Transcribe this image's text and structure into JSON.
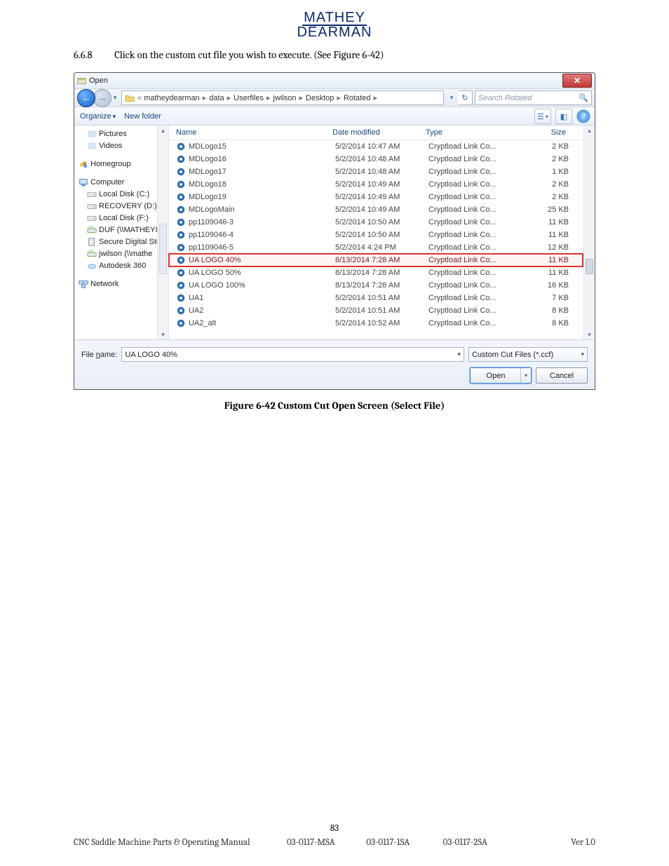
{
  "header": {
    "brand_line1": "Mathey",
    "brand_line2": "Dearman"
  },
  "instruction": {
    "number": "6.6.8",
    "text": "Click on the custom cut file you wish to execute. (See Figure 6-42)"
  },
  "dialog": {
    "title": "Open",
    "breadcrumb": [
      "matheydearman",
      "data",
      "Userfiles",
      "jwilson",
      "Desktop",
      "Rotated"
    ],
    "search_placeholder": "Search Rotated",
    "toolbar": {
      "organize": "Organize",
      "new_folder": "New folder"
    },
    "columns": {
      "name": "Name",
      "date": "Date modified",
      "type": "Type",
      "size": "Size"
    },
    "sidebar": [
      {
        "icon": "pictures",
        "label": "Pictures",
        "indent": 1
      },
      {
        "icon": "videos",
        "label": "Videos",
        "indent": 1
      },
      {
        "gap": true
      },
      {
        "icon": "homegroup",
        "label": "Homegroup",
        "indent": 0
      },
      {
        "gap": true
      },
      {
        "icon": "computer",
        "label": "Computer",
        "indent": 0
      },
      {
        "icon": "disk",
        "label": "Local Disk (C:)",
        "indent": 1
      },
      {
        "icon": "disk",
        "label": "RECOVERY (D:)",
        "indent": 1
      },
      {
        "icon": "disk",
        "label": "Local Disk (F:)",
        "indent": 1
      },
      {
        "icon": "netdrive",
        "label": "DUF (\\\\MATHEYI",
        "indent": 1
      },
      {
        "icon": "sd",
        "label": "Secure Digital Sto",
        "indent": 1
      },
      {
        "icon": "netdrive",
        "label": "jwilson (\\\\mathe",
        "indent": 1
      },
      {
        "icon": "cloud",
        "label": "Autodesk 360",
        "indent": 1
      },
      {
        "gap": true
      },
      {
        "icon": "network",
        "label": "Network",
        "indent": 0
      }
    ],
    "files": [
      {
        "name": "MDLogo15",
        "date": "5/2/2014 10:47 AM",
        "type": "Cryptload Link Co...",
        "size": "2 KB"
      },
      {
        "name": "MDLogo16",
        "date": "5/2/2014 10:48 AM",
        "type": "Cryptload Link Co...",
        "size": "2 KB"
      },
      {
        "name": "MDLogo17",
        "date": "5/2/2014 10:48 AM",
        "type": "Cryptload Link Co...",
        "size": "1 KB"
      },
      {
        "name": "MDLogo18",
        "date": "5/2/2014 10:49 AM",
        "type": "Cryptload Link Co...",
        "size": "2 KB"
      },
      {
        "name": "MDLogo19",
        "date": "5/2/2014 10:49 AM",
        "type": "Cryptload Link Co...",
        "size": "2 KB"
      },
      {
        "name": "MDLogoMain",
        "date": "5/2/2014 10:49 AM",
        "type": "Cryptload Link Co...",
        "size": "25 KB"
      },
      {
        "name": "pp1109046-3",
        "date": "5/2/2014 10:50 AM",
        "type": "Cryptload Link Co...",
        "size": "11 KB"
      },
      {
        "name": "pp1109046-4",
        "date": "5/2/2014 10:50 AM",
        "type": "Cryptload Link Co...",
        "size": "11 KB"
      },
      {
        "name": "pp1109046-5",
        "date": "5/2/2014 4:24 PM",
        "type": "Cryptload Link Co...",
        "size": "12 KB"
      },
      {
        "name": "UA LOGO 40%",
        "date": "8/13/2014 7:28 AM",
        "type": "Cryptload Link Co...",
        "size": "11 KB",
        "selected": true
      },
      {
        "name": "UA LOGO 50%",
        "date": "8/13/2014 7:28 AM",
        "type": "Cryptload Link Co...",
        "size": "11 KB"
      },
      {
        "name": "UA LOGO 100%",
        "date": "8/13/2014 7:28 AM",
        "type": "Cryptload Link Co...",
        "size": "16 KB"
      },
      {
        "name": "UA1",
        "date": "5/2/2014 10:51 AM",
        "type": "Cryptload Link Co...",
        "size": "7 KB"
      },
      {
        "name": "UA2",
        "date": "5/2/2014 10:51 AM",
        "type": "Cryptload Link Co...",
        "size": "8 KB"
      },
      {
        "name": "UA2_alt",
        "date": "5/2/2014 10:52 AM",
        "type": "Cryptload Link Co...",
        "size": "8 KB"
      }
    ],
    "filename": "UA LOGO 40%",
    "filetype": "Custom Cut Files (*.ccf)",
    "buttons": {
      "open": "Open",
      "cancel": "Cancel"
    }
  },
  "caption": "Figure 6-42 Custom Cut Open Screen (Select File)",
  "footer": {
    "page": "83",
    "title": "CNC Saddle Machine Parts & Operating Manual",
    "codes": [
      "03-0117-MSA",
      "03-0117-1SA",
      "03-0117-2SA"
    ],
    "version": "Ver 1.0"
  },
  "icons": {
    "pictures": "#5aa0e0",
    "videos": "#5aa0e0",
    "homegroup": "#d28a2d",
    "computer": "#3a6fb7",
    "disk": "#9aa6b3",
    "netdrive": "#6aa84f",
    "sd": "#7a8a9a",
    "cloud": "#6aa0d6",
    "network": "#3a6fb7",
    "file": "#2f6fb0"
  }
}
